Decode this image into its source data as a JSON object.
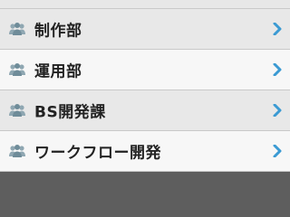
{
  "list": {
    "items": [
      {
        "label": "制作部",
        "icon": "people-icon"
      },
      {
        "label": "運用部",
        "icon": "people-icon"
      },
      {
        "label": "BS開発課",
        "icon": "people-icon"
      },
      {
        "label": "ワークフロー開発",
        "icon": "people-icon"
      }
    ]
  },
  "colors": {
    "chevron": "#3a9ad3",
    "icon": "#7f9aa6",
    "footer": "#5e5e5e"
  }
}
